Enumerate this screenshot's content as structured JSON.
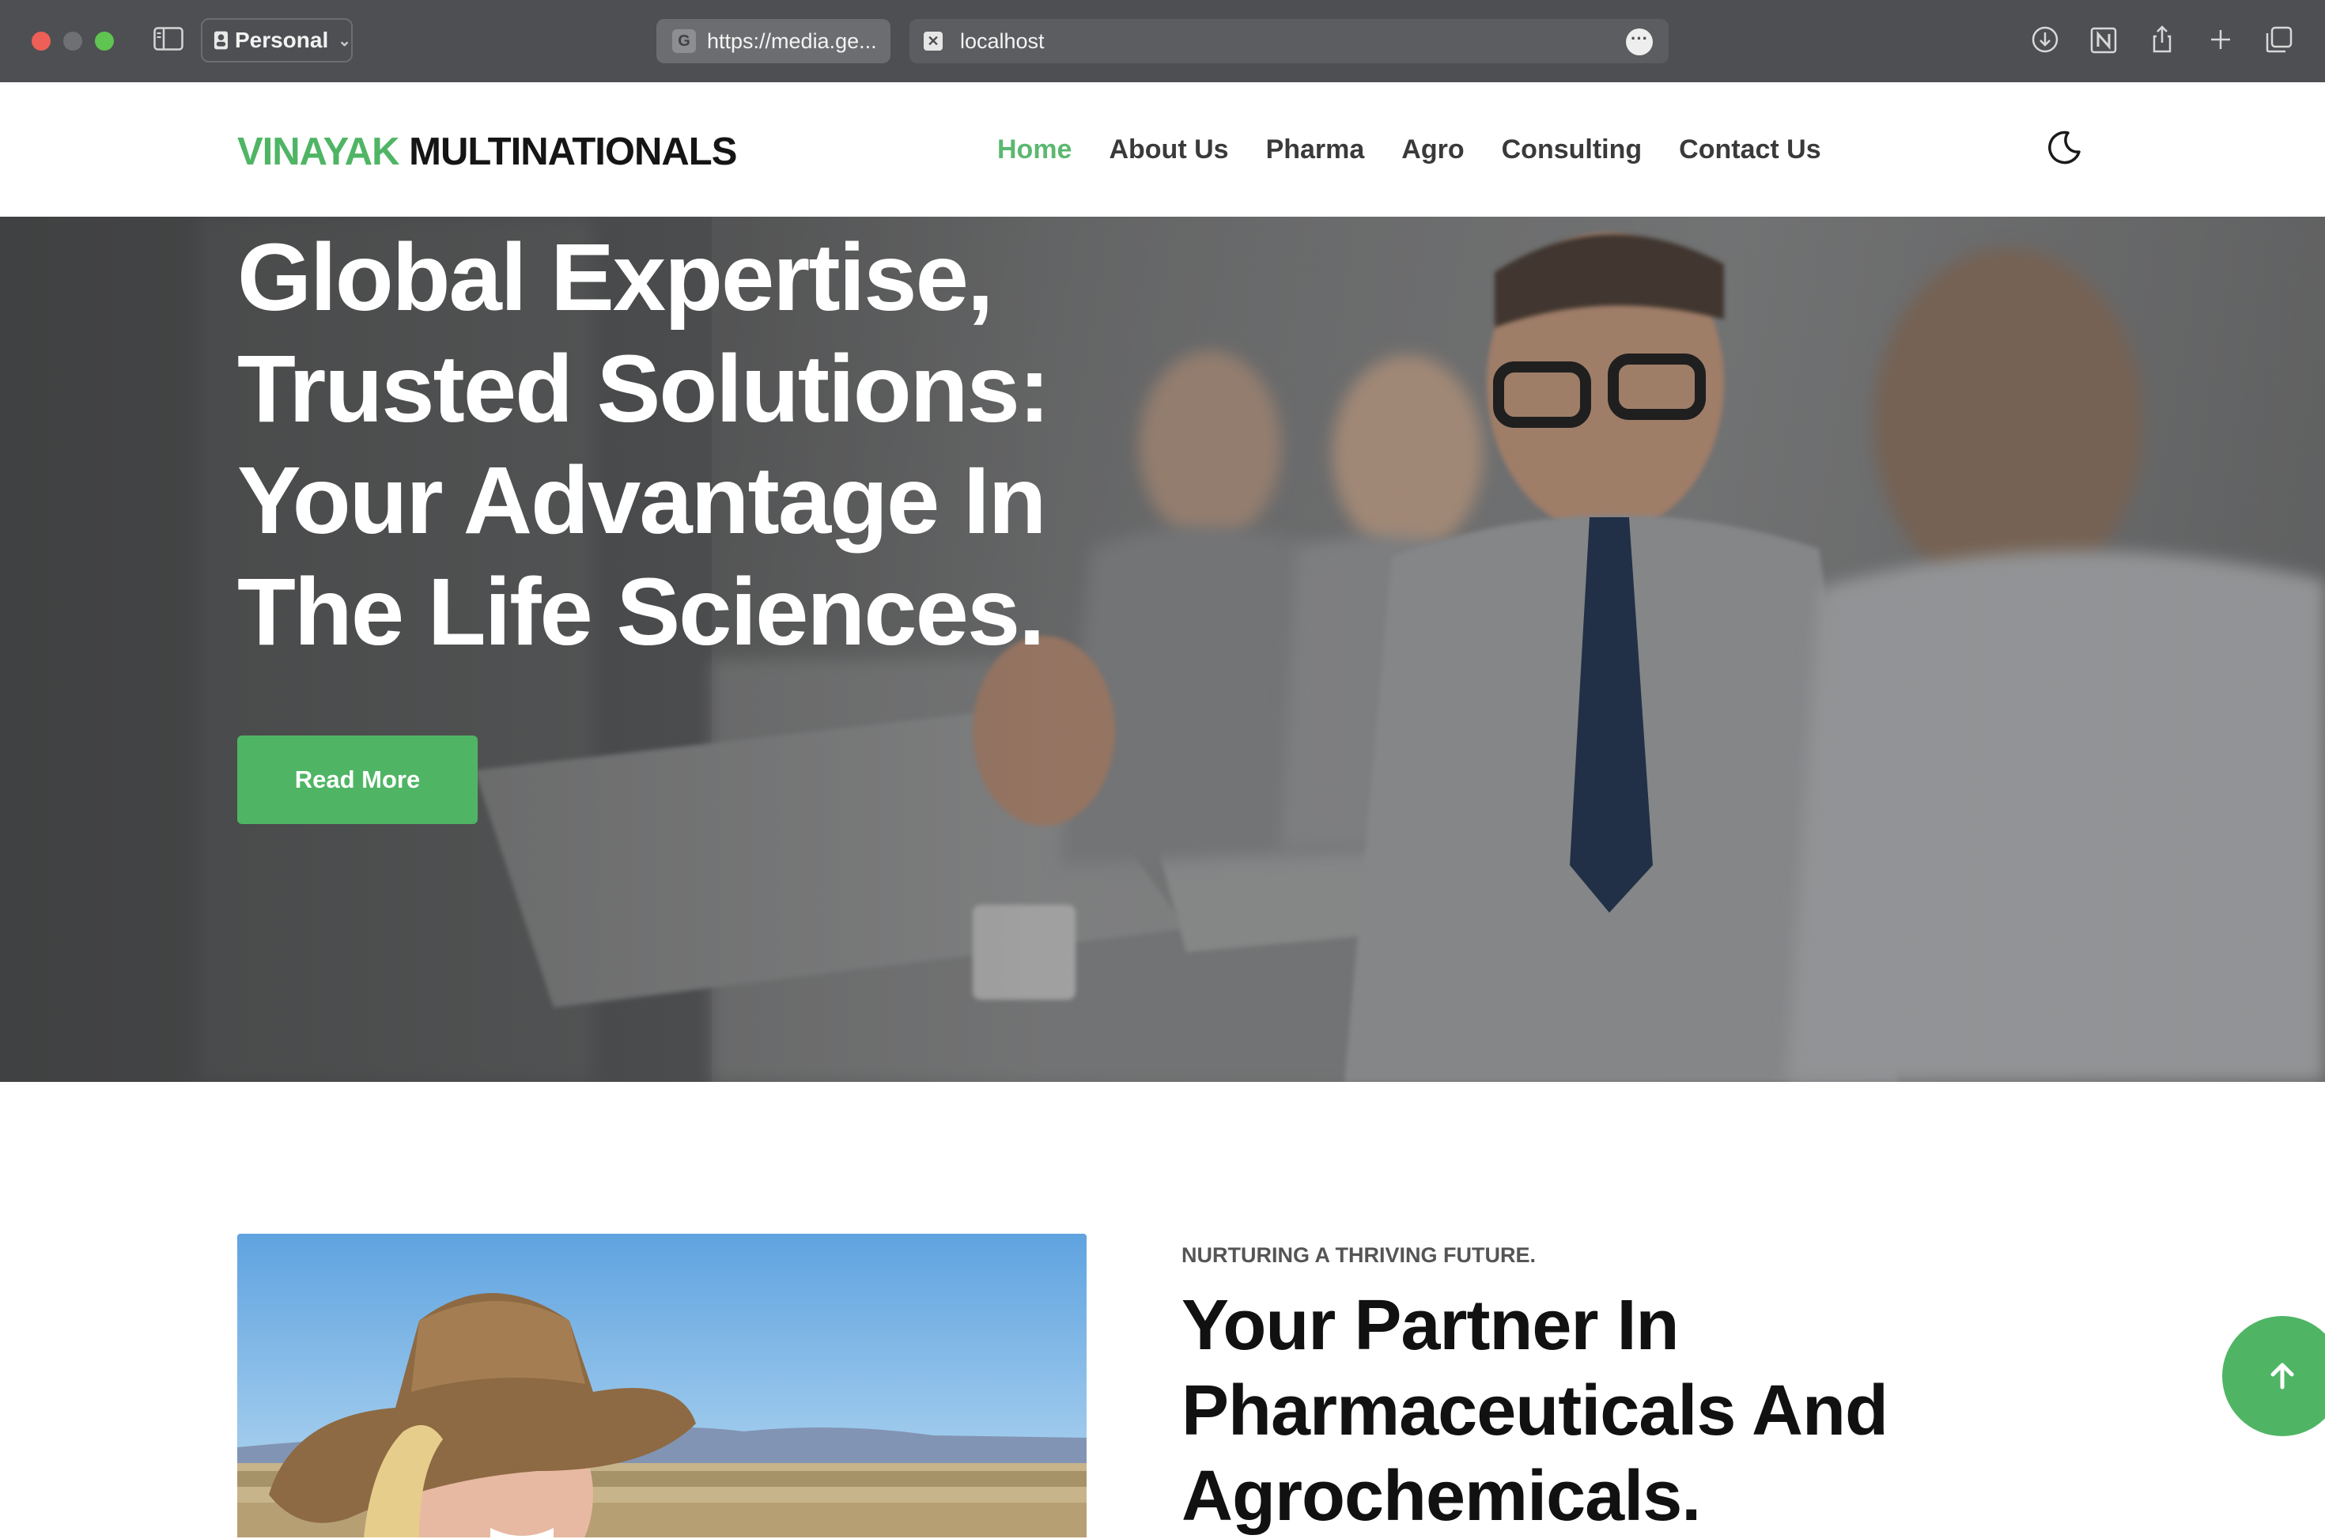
{
  "browser": {
    "profile_label": "Personal",
    "tabs": [
      {
        "label": "https://media.ge...",
        "favicon": "G"
      },
      {
        "label": "localhost",
        "favicon": "x"
      }
    ],
    "icons": [
      "sidebar-icon",
      "download-icon",
      "notion-icon",
      "share-icon",
      "new-tab-icon",
      "tab-overview-icon"
    ]
  },
  "header": {
    "logo_primary": "VINAYAK",
    "logo_secondary": "MULTINATIONALS",
    "nav": [
      {
        "label": "Home",
        "active": true
      },
      {
        "label": "About Us",
        "active": false
      },
      {
        "label": "Pharma",
        "active": false
      },
      {
        "label": "Agro",
        "active": false
      },
      {
        "label": "Consulting",
        "active": false
      },
      {
        "label": "Contact Us",
        "active": false
      }
    ]
  },
  "hero": {
    "title_lines": [
      "Global Expertise,",
      "Trusted Solutions:",
      "Your Advantage In",
      "The Life Sciences."
    ],
    "cta_label": "Read More"
  },
  "about": {
    "eyebrow": "NURTURING A THRIVING FUTURE.",
    "title_lines": [
      "Your Partner In",
      "Pharmaceuticals And",
      "Agrochemicals."
    ]
  },
  "colors": {
    "accent": "#4fb565",
    "nav_active": "#5cb870",
    "chrome_bg": "#4d4f52",
    "text_dark": "#111111"
  }
}
